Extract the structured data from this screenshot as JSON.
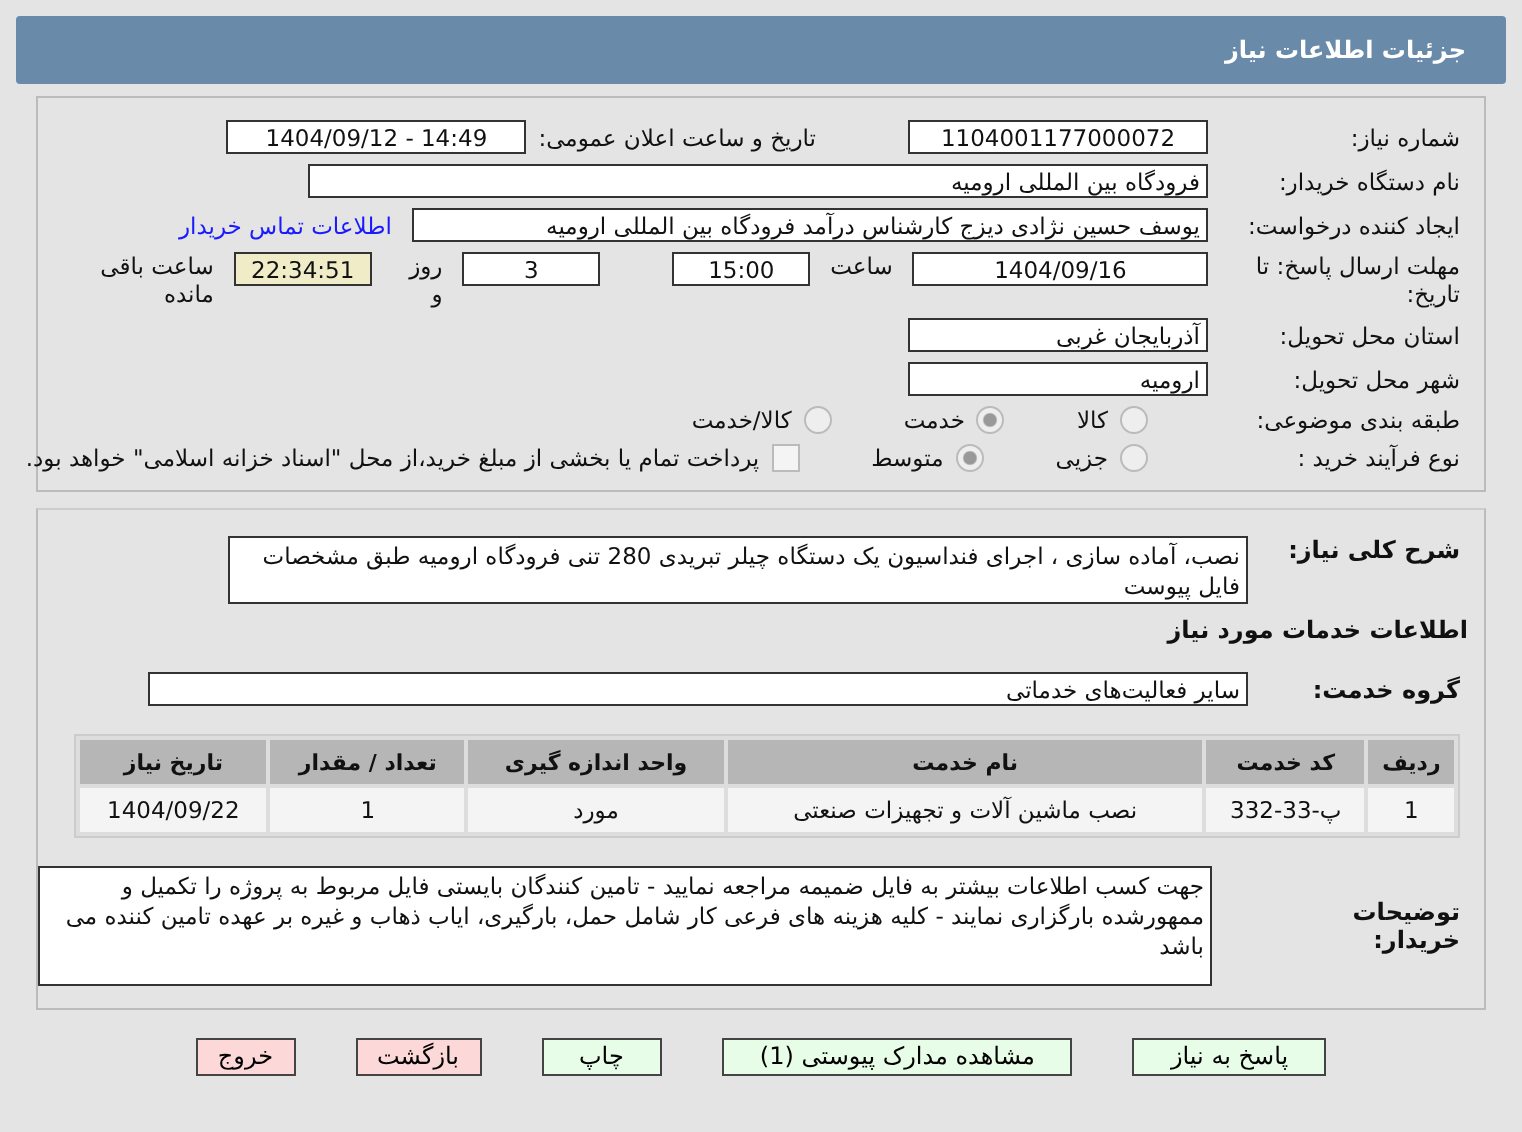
{
  "header": {
    "title": "جزئیات اطلاعات نیاز"
  },
  "fields": {
    "need_number": {
      "label": "شماره نیاز:",
      "value": "1104001177000072"
    },
    "announce": {
      "label": "تاریخ و ساعت اعلان عمومی:",
      "value": "1404/09/12 - 14:49"
    },
    "buyer": {
      "label": "نام دستگاه خریدار:",
      "value": "فرودگاه بین المللی ارومیه"
    },
    "creator": {
      "label": "ایجاد کننده درخواست:",
      "value": "یوسف حسین نژادی دیزج کارشناس درآمد فرودگاه بین المللی ارومیه",
      "link": "اطلاعات تماس خریدار"
    },
    "deadline": {
      "label": "مهلت ارسال پاسخ: تا تاریخ:",
      "date": "1404/09/16",
      "time_label": "ساعت",
      "time": "15:00",
      "days": "3",
      "days_label": "روز و",
      "remaining": "22:34:51",
      "remaining_label": "ساعت باقی مانده"
    },
    "province": {
      "label": "استان محل تحویل:",
      "value": "آذربایجان غربی"
    },
    "city": {
      "label": "شهر محل تحویل:",
      "value": "ارومیه"
    }
  },
  "category": {
    "label": "طبقه بندی موضوعی:",
    "options": [
      {
        "label": "کالا",
        "selected": false
      },
      {
        "label": "خدمت",
        "selected": true
      },
      {
        "label": "کالا/خدمت",
        "selected": false
      }
    ]
  },
  "purchase_type": {
    "label": "نوع فرآیند خرید :",
    "options": [
      {
        "label": "جزیی",
        "selected": false
      },
      {
        "label": "متوسط",
        "selected": true
      }
    ],
    "payment": {
      "checked": false,
      "label": "پرداخت تمام یا بخشی از مبلغ خرید،از محل \"اسناد خزانه اسلامی\" خواهد بود."
    }
  },
  "description": {
    "label": "شرح کلی نیاز:",
    "value": "نصب، آماده سازی ، اجرای فنداسیون یک دستگاه چیلر تبریدی 280 تنی فرودگاه ارومیه طبق مشخصات فایل پیوست"
  },
  "services_title": "اطلاعات خدمات مورد نیاز",
  "service_group": {
    "label": "گروه خدمت:",
    "value": "سایر فعالیت‌های خدماتی"
  },
  "table": {
    "columns": [
      "ردیف",
      "کد خدمت",
      "نام خدمت",
      "واحد اندازه گیری",
      "تعداد / مقدار",
      "تاریخ نیاز"
    ],
    "rows": [
      [
        "1",
        "پ-33-332",
        "نصب ماشین آلات و تجهیزات صنعتی",
        "مورد",
        "1",
        "1404/09/22"
      ]
    ]
  },
  "buyer_notes": {
    "label": "توضیحات خریدار:",
    "value": "جهت کسب اطلاعات بیشتر به فایل ضمیمه مراجعه نمایید - تامین کنندگان بایستی فایل مربوط به پروژه را تکمیل و ممهورشده بارگزاری نمایند - کلیه هزینه های فرعی کار شامل حمل، بارگیری، ایاب ذهاب و غیره بر عهده تامین کننده می باشد"
  },
  "buttons": [
    {
      "label": "پاسخ به نیاز",
      "kind": "green"
    },
    {
      "label": "مشاهده مدارک پیوستی (1)",
      "kind": "green"
    },
    {
      "label": "چاپ",
      "kind": "green"
    },
    {
      "label": "بازگشت",
      "kind": "red"
    },
    {
      "label": "خروج",
      "kind": "red"
    }
  ]
}
